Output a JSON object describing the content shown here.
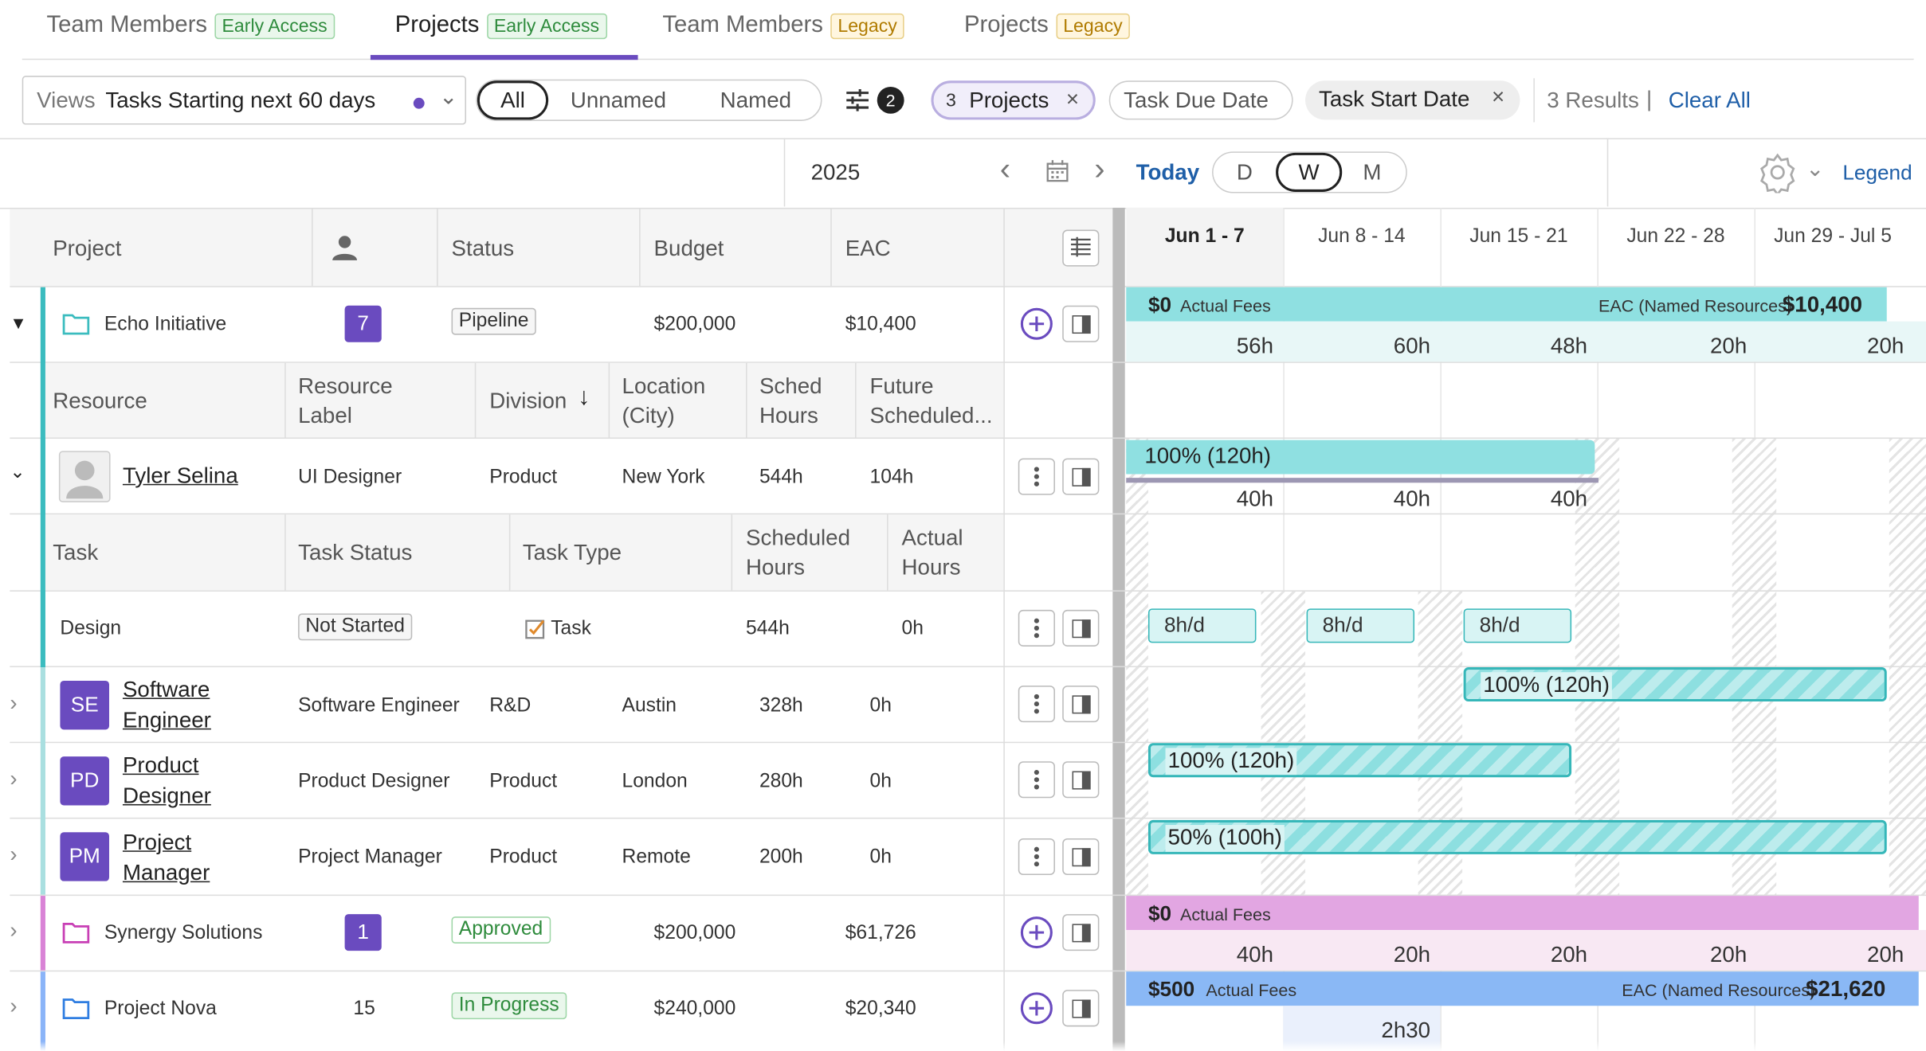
{
  "tabs": [
    {
      "label": "Team Members",
      "badge": "Early Access"
    },
    {
      "label": "Projects",
      "badge": "Early Access"
    },
    {
      "label": "Team Members",
      "badge": "Legacy"
    },
    {
      "label": "Projects",
      "badge": "Legacy"
    }
  ],
  "filters": {
    "views_label": "Views",
    "views_value": "Tasks Starting next 60 days",
    "seg": [
      "All",
      "Unnamed",
      "Named"
    ],
    "filter_count": "2",
    "projects_count": "3",
    "projects_label": "Projects",
    "due_label": "Task Due Date",
    "start_label": "Task Start Date",
    "results": "3 Results",
    "clear": "Clear All"
  },
  "timeline": {
    "year": "2025",
    "today": "Today",
    "scale": [
      "D",
      "W",
      "M"
    ],
    "legend": "Legend",
    "weeks": [
      "Jun 1 - 7",
      "Jun 8 - 14",
      "Jun 15 - 21",
      "Jun 22 - 28",
      "Jun 29 - Jul 5"
    ]
  },
  "proj_header": {
    "project": "Project",
    "status": "Status",
    "budget": "Budget",
    "eac": "EAC"
  },
  "projects": [
    {
      "name": "Echo Initiative",
      "count": "7",
      "status": "Pipeline",
      "budget": "$200,000",
      "eac": "$10,400",
      "fees": "$0",
      "fees_label": "Actual Fees",
      "eac_label": "EAC (Named Resources)",
      "eac_value": "$10,400",
      "hours": [
        "56h",
        "60h",
        "48h",
        "20h",
        "20h"
      ]
    },
    {
      "name": "Synergy Solutions",
      "count": "1",
      "status": "Approved",
      "budget": "$200,000",
      "eac": "$61,726",
      "fees": "$0",
      "fees_label": "Actual Fees",
      "hours": [
        "40h",
        "20h",
        "20h",
        "20h",
        "20h"
      ]
    },
    {
      "name": "Project Nova",
      "count": "15",
      "status": "In Progress",
      "budget": "$240,000",
      "eac": "$20,340",
      "fees": "$500",
      "fees_label": "Actual Fees",
      "eac_label": "EAC (Named Resources)",
      "eac_value": "$21,620",
      "hours": [
        "2h30"
      ]
    }
  ],
  "res_header": {
    "resource": "Resource",
    "label": "Resource Label",
    "division": "Division",
    "location": "Location (City)",
    "sched": "Sched Hours",
    "future": "Future Scheduled..."
  },
  "resources": [
    {
      "name": "Tyler Selina",
      "label": "UI Designer",
      "division": "Product",
      "location": "New York",
      "sched": "544h",
      "future": "104h",
      "alloc": "100% (120h)",
      "hours": [
        "40h",
        "40h",
        "40h"
      ]
    },
    {
      "initials": "SE",
      "name": "Software Engineer",
      "label": "Software Engineer",
      "division": "R&D",
      "location": "Austin",
      "sched": "328h",
      "future": "0h",
      "alloc": "100% (120h)"
    },
    {
      "initials": "PD",
      "name": "Product Designer",
      "label": "Product Designer",
      "division": "Product",
      "location": "London",
      "sched": "280h",
      "future": "0h",
      "alloc": "100% (120h)"
    },
    {
      "initials": "PM",
      "name": "Project Manager",
      "label": "Project Manager",
      "division": "Product",
      "location": "Remote",
      "sched": "200h",
      "future": "0h",
      "alloc": "50% (100h)"
    }
  ],
  "task_header": {
    "task": "Task",
    "status": "Task Status",
    "type": "Task Type",
    "sched": "Scheduled Hours",
    "actual": "Actual Hours"
  },
  "task": {
    "name": "Design",
    "status": "Not Started",
    "type": "Task",
    "sched": "544h",
    "actual": "0h",
    "chips": [
      "8h/d",
      "8h/d",
      "8h/d"
    ]
  }
}
